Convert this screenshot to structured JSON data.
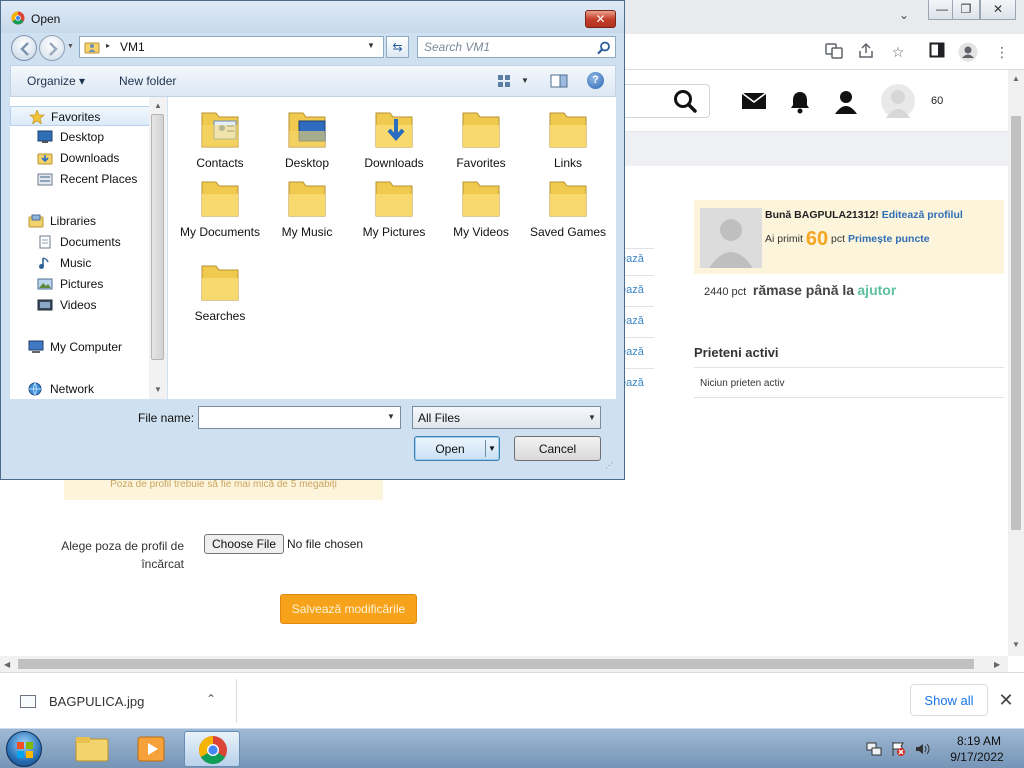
{
  "colors": {
    "accent_orange": "#f7a21b",
    "link_blue": "#2f6fb6",
    "help_green": "#5cc0a0",
    "panel_cream": "#fdf4dc",
    "taskbar_blue": "#7594b6"
  },
  "dialog": {
    "title": "Open",
    "close_glyph": "✕",
    "address": {
      "path": "VM1",
      "separator": "▸"
    },
    "search_placeholder": "Search VM1",
    "command_bar": {
      "organize": "Organize ▾",
      "new_folder": "New folder"
    },
    "nav": [
      {
        "label": "Favorites",
        "icon": "star-icon"
      },
      {
        "label": "Desktop",
        "icon": "desktop-icon"
      },
      {
        "label": "Downloads",
        "icon": "downloads-folder-icon"
      },
      {
        "label": "Recent Places",
        "icon": "recent-places-icon"
      },
      {
        "label": "Libraries",
        "icon": "libraries-icon"
      },
      {
        "label": "Documents",
        "icon": "documents-icon"
      },
      {
        "label": "Music",
        "icon": "music-icon"
      },
      {
        "label": "Pictures",
        "icon": "pictures-icon"
      },
      {
        "label": "Videos",
        "icon": "videos-icon"
      },
      {
        "label": "My Computer",
        "icon": "computer-icon"
      },
      {
        "label": "Network",
        "icon": "network-icon"
      }
    ],
    "folders": [
      {
        "label": "Contacts",
        "icon": "contacts-folder-icon"
      },
      {
        "label": "Desktop",
        "icon": "desktop-folder-icon"
      },
      {
        "label": "Downloads",
        "icon": "downloads-folder-icon"
      },
      {
        "label": "Favorites",
        "icon": "folder-icon"
      },
      {
        "label": "Links",
        "icon": "folder-icon"
      },
      {
        "label": "My Documents",
        "icon": "folder-icon"
      },
      {
        "label": "My Music",
        "icon": "folder-icon"
      },
      {
        "label": "My Pictures",
        "icon": "folder-icon"
      },
      {
        "label": "My Videos",
        "icon": "folder-icon"
      },
      {
        "label": "Saved Games",
        "icon": "folder-icon"
      },
      {
        "label": "Searches",
        "icon": "folder-icon"
      }
    ],
    "filename_label": "File name:",
    "filename_value": "",
    "filetype": "All Files",
    "open_label": "Open",
    "cancel_label": "Cancel"
  },
  "browser": {
    "window_controls": {
      "minimize": "—",
      "restore": "❐",
      "close": "✕"
    }
  },
  "site": {
    "header_points": "60",
    "side_links": [
      "ează",
      "ează",
      "ează",
      "ează",
      "ează"
    ],
    "profile": {
      "greeting": "Bună BAGPULA21312!",
      "edit_link": "Editează profilul",
      "points_prefix": "Ai primit",
      "points_value": "60",
      "points_unit": "pct",
      "get_points": "Primește puncte"
    },
    "remaining": {
      "value": "2440 pct",
      "text": "rămase până la",
      "link": "ajutor"
    },
    "friends_title": "Prieteni activi",
    "friends_none": "Niciun prieten activ",
    "photo_note": "Poza de profil trebuie să fie mai mică de 5 megabiți",
    "choose_label": "Alege poza de profil de încărcat",
    "choose_button": "Choose File",
    "no_file": "No file chosen",
    "save_button": "Salvează modificările"
  },
  "downloads": {
    "file_name": "BAGPULICA.jpg",
    "show_all": "Show all",
    "close_glyph": "✕"
  },
  "taskbar": {
    "time": "8:19 AM",
    "date": "9/17/2022"
  }
}
